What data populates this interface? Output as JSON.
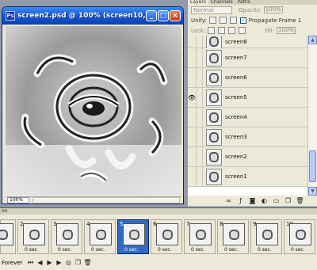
{
  "document": {
    "title": "screen2.psd @ 100% (screen10, RGB/8)",
    "zoom": "100%",
    "buttons": {
      "minimize": "_",
      "maximize": "□",
      "close": "×"
    }
  },
  "layers_panel": {
    "tabs": [
      "Layers",
      "Channels",
      "Paths"
    ],
    "mode": "Normal",
    "opacity_label": "Opacity:",
    "opacity_value": "100%",
    "unify_label": "Unify:",
    "propagate_label": "Propagate Frame 1",
    "lock_label": "Lock:",
    "fill_label": "Fill:",
    "fill_value": "100%",
    "layers": [
      {
        "name": "screen8",
        "visible": false
      },
      {
        "name": "screen7",
        "visible": false
      },
      {
        "name": "screen6",
        "visible": false
      },
      {
        "name": "screen5",
        "visible": true
      },
      {
        "name": "screen4",
        "visible": false
      },
      {
        "name": "screen3",
        "visible": false
      },
      {
        "name": "screen2",
        "visible": false
      },
      {
        "name": "screen1",
        "visible": false
      }
    ]
  },
  "animation": {
    "tab_label": "on",
    "loop": "Forever",
    "frames": [
      {
        "number": "",
        "delay": ""
      },
      {
        "number": "2",
        "delay": "0 sec."
      },
      {
        "number": "3",
        "delay": "0 sec."
      },
      {
        "number": "4",
        "delay": "0 sec."
      },
      {
        "number": "5",
        "delay": "0 sec.",
        "selected": true
      },
      {
        "number": "6",
        "delay": "0 sec."
      },
      {
        "number": "7",
        "delay": "0 sec."
      },
      {
        "number": "8",
        "delay": "0 sec."
      },
      {
        "number": "9",
        "delay": "0 sec."
      },
      {
        "number": "10",
        "delay": "0 sec."
      }
    ]
  }
}
